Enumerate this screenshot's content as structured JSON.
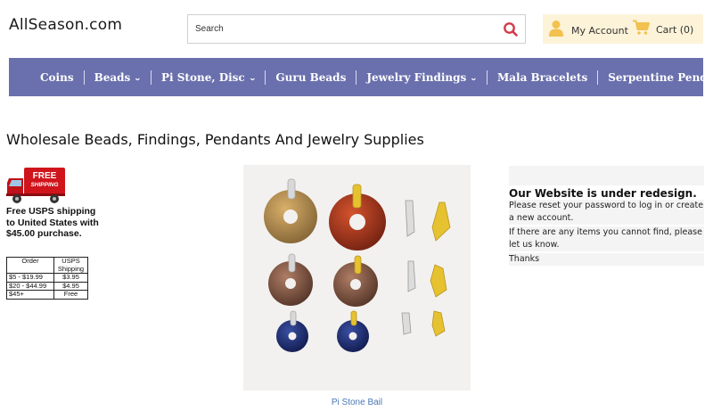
{
  "site": {
    "logo": "AllSeason.com"
  },
  "search": {
    "placeholder": "Search"
  },
  "account": {
    "label": "My Account",
    "cart_label": "Cart (0)"
  },
  "nav": [
    {
      "label": "Coins",
      "dropdown": false
    },
    {
      "label": "Beads",
      "dropdown": true
    },
    {
      "label": "Pi Stone, Disc",
      "dropdown": true
    },
    {
      "label": "Guru Beads",
      "dropdown": false
    },
    {
      "label": "Jewelry Findings",
      "dropdown": true
    },
    {
      "label": "Mala Bracelets",
      "dropdown": false
    },
    {
      "label": "Serpentine Pendants",
      "dropdown": false
    }
  ],
  "page": {
    "title": "Wholesale Beads, Findings, Pendants And Jewelry Supplies"
  },
  "shipping": {
    "badge_line1": "FREE",
    "badge_line2": "SHIPPING",
    "text": "Free USPS shipping to United States with $45.00 purchase.",
    "table_headers": [
      "Order",
      "USPS Shipping"
    ],
    "table_rows": [
      [
        "$5 - $19.99",
        "$3.95"
      ],
      [
        "$20 - $44.99",
        "$4.95"
      ],
      [
        "$45+",
        "Free"
      ]
    ]
  },
  "product": {
    "caption": "Pi Stone Bail"
  },
  "notice": {
    "title": "Our Website is under redesign.",
    "lines": [
      "Please reset your password to log in or create a new account.",
      "If there are any items you cannot find, please let us know.",
      "Thanks"
    ]
  },
  "colors": {
    "nav_bg": "#6a70ad",
    "account_bg": "#fdf3d9",
    "search_icon": "#d23a4a",
    "user_icon": "#f2c14e",
    "link": "#4a78b5",
    "truck_red": "#d0141c"
  },
  "icons": {
    "search": "search-icon",
    "user": "user-icon",
    "cart": "cart-icon",
    "chevron": "chevron-down-icon",
    "truck": "truck-icon"
  }
}
